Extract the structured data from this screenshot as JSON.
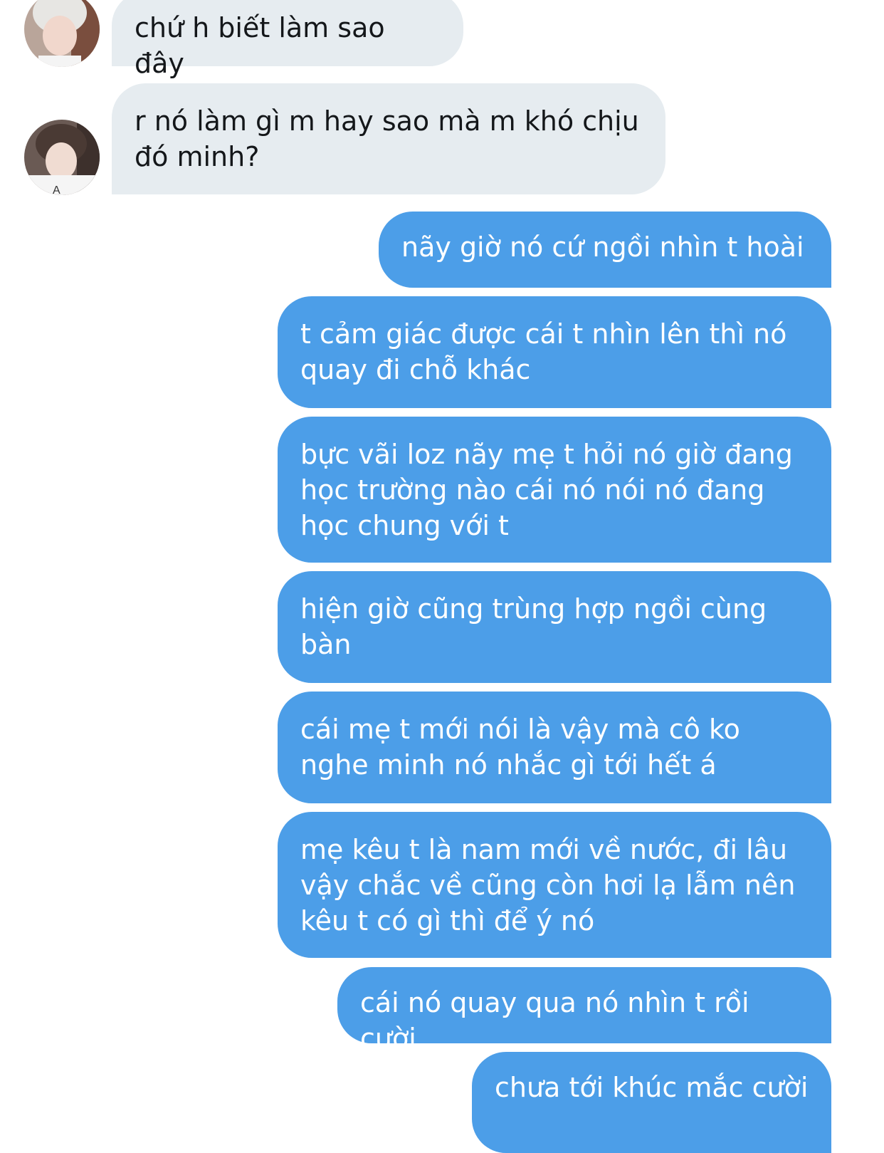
{
  "conversation": {
    "messages": [
      {
        "side": "in",
        "text": "chứ h biết làm sao đây"
      },
      {
        "side": "in",
        "text": "r nó làm gì m hay sao mà m khó chịu đó minh?"
      },
      {
        "side": "out",
        "text": "nãy giờ nó cứ ngồi nhìn t hoài"
      },
      {
        "side": "out",
        "text": "t cảm giác được cái t nhìn lên thì nó quay đi chỗ khác"
      },
      {
        "side": "out",
        "text": "bực vãi loz nãy mẹ t hỏi nó giờ đang học trường nào cái nó nói nó đang học chung với t"
      },
      {
        "side": "out",
        "text": "hiện giờ cũng trùng hợp ngồi cùng bàn"
      },
      {
        "side": "out",
        "text": "cái mẹ t mới nói là vậy mà cô ko nghe minh nó nhắc gì tới hết á"
      },
      {
        "side": "out",
        "text": "mẹ kêu t là nam mới về nước, đi lâu vậy chắc về cũng còn hơi lạ lẫm nên kêu t có gì thì để ý nó"
      },
      {
        "side": "out",
        "text": "cái nó quay qua nó nhìn t rồi cười"
      },
      {
        "side": "out",
        "text": "chưa tới khúc mắc cười"
      }
    ]
  },
  "colors": {
    "incoming_bubble": "#e6ecf0",
    "outgoing_bubble": "#4c9ee8",
    "incoming_text": "#14171a",
    "outgoing_text": "#ffffff"
  }
}
